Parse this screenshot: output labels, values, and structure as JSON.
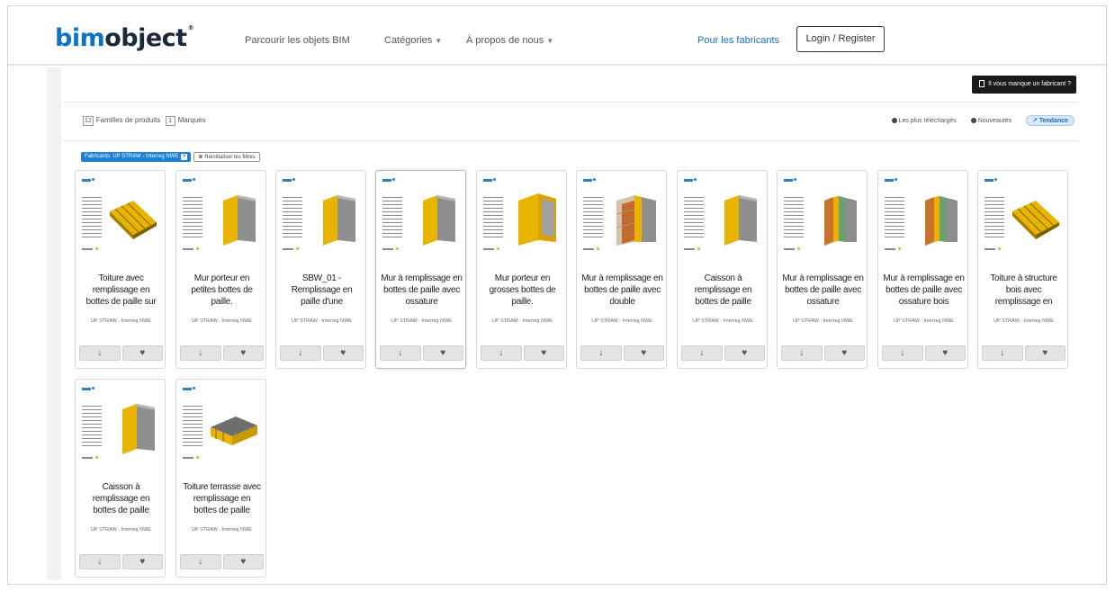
{
  "header": {
    "logo_bim": "bim",
    "logo_object": "object",
    "logo_mark": "®",
    "nav_browse": "Parcourir les objets BIM",
    "nav_categories": "Catégories",
    "nav_about": "À propos de nous",
    "nav_manufacturers": "Pour les fabricants",
    "login": "Login / Register"
  },
  "toolbar": {
    "missing_manufacturer": "Il vous manque un fabricant ?",
    "families_count": "12",
    "families_label": "Familles de produits",
    "brands_count": "1",
    "brands_label": "Marques",
    "sort_most_downloaded": "Les plus téléchargés",
    "sort_new": "Nouveautés",
    "sort_trending": "Tendance"
  },
  "filters": {
    "manufacturer_chip": "Fabricants: UP STRAW - Interreg NWE",
    "reset": "Réinitialiser les filtres"
  },
  "actions": {
    "download_icon": "↓",
    "favorite_icon": "♥"
  },
  "products": [
    {
      "title": "Toiture avec remplissage en bottes de paille sur",
      "manufacturer": "UP STRAW - Interreg NWE",
      "thumbnail": "roof-slab",
      "highlight": false
    },
    {
      "title": "Mur porteur en petites bottes de paille.",
      "manufacturer": "UP STRAW - Interreg NWE",
      "thumbnail": "wall-yellow",
      "highlight": false
    },
    {
      "title": "SBW_01 - Remplissage en paille d'une",
      "manufacturer": "UP STRAW - Interreg NWE",
      "thumbnail": "wall-yellow",
      "highlight": false
    },
    {
      "title": "Mur à remplissage en bottes de paille avec ossature",
      "manufacturer": "UP STRAW - Interreg NWE",
      "thumbnail": "wall-yellow",
      "highlight": true
    },
    {
      "title": "Mur porteur en grosses bottes de paille.",
      "manufacturer": "UP STRAW - Interreg NWE",
      "thumbnail": "wall-block",
      "highlight": false
    },
    {
      "title": "Mur à remplissage en bottes de paille avec double",
      "manufacturer": "UP STRAW - Interreg NWE",
      "thumbnail": "wall-double",
      "highlight": false
    },
    {
      "title": "Caisson à remplissage en bottes de paille",
      "manufacturer": "UP STRAW - Interreg NWE",
      "thumbnail": "wall-yellow",
      "highlight": false
    },
    {
      "title": "Mur à remplissage en bottes de paille avec ossature",
      "manufacturer": "UP STRAW - Interreg NWE",
      "thumbnail": "wall-green",
      "highlight": false
    },
    {
      "title": "Mur à remplissage en bottes de paille avec ossature bois",
      "manufacturer": "UP STRAW - Interreg NWE",
      "thumbnail": "wall-green",
      "highlight": false
    },
    {
      "title": "Toiture à structure bois avec remplissage en",
      "manufacturer": "UP STRAW - Interreg NWE",
      "thumbnail": "roof-slab",
      "highlight": false
    },
    {
      "title": "Caisson à remplissage en bottes de paille",
      "manufacturer": "UP STRAW - Interreg NWE",
      "thumbnail": "wall-yellow",
      "highlight": false
    },
    {
      "title": "Toiture terrasse avec remplissage en bottes de paille",
      "manufacturer": "UP STRAW - Interreg NWE",
      "thumbnail": "roof-flat",
      "highlight": false
    }
  ],
  "colors": {
    "brand_blue": "#0a74c8",
    "straw_yellow": "#e9b400",
    "filter_chip": "#1d7fd6"
  }
}
